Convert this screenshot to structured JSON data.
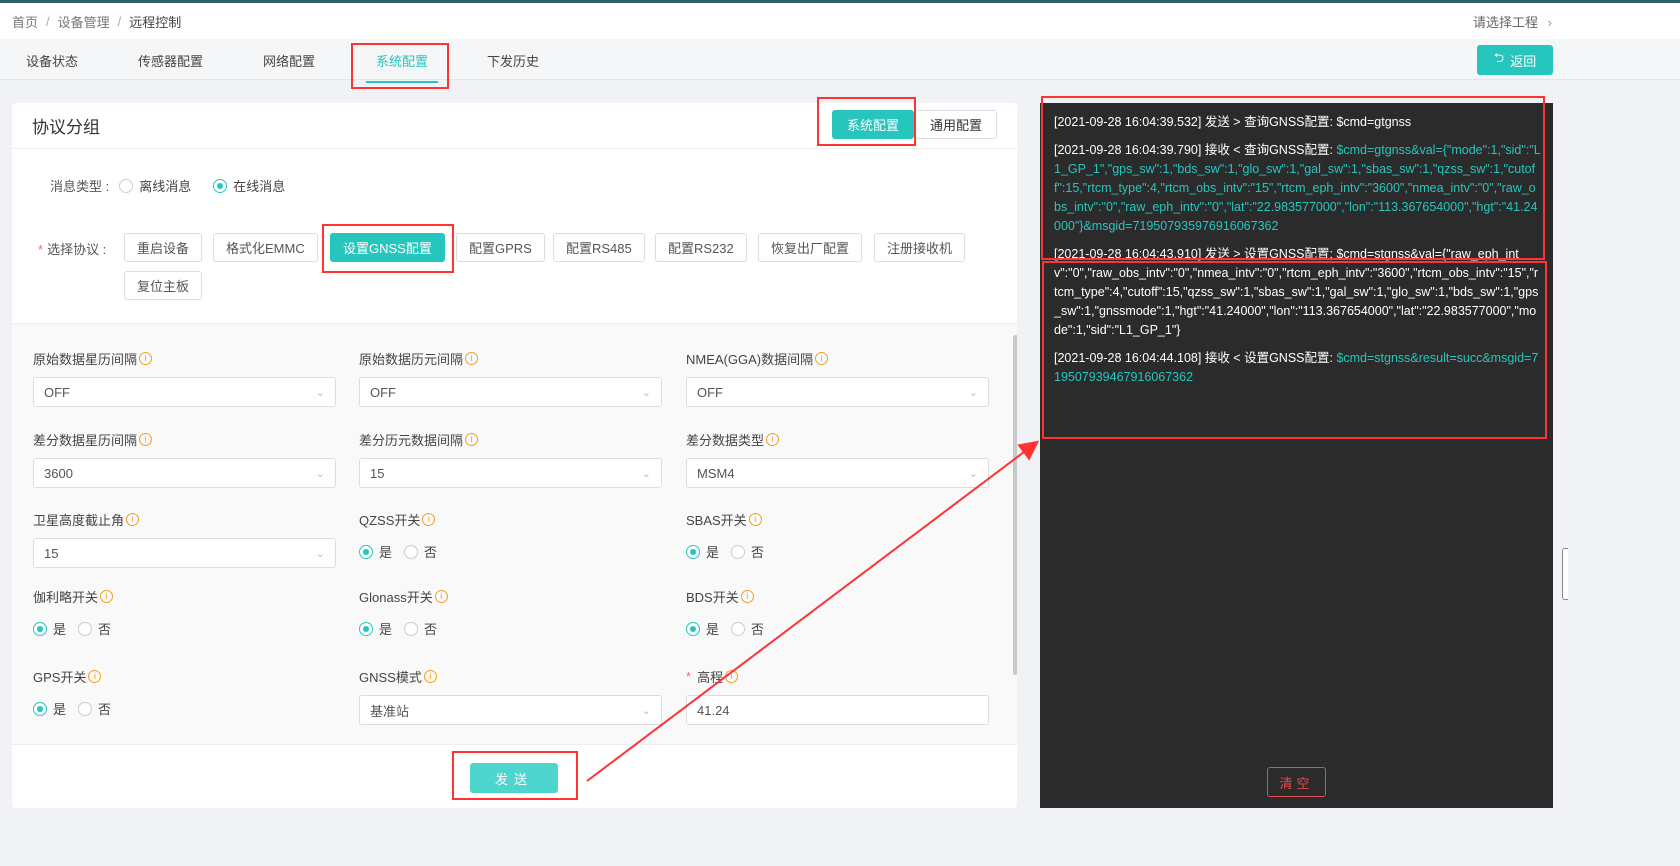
{
  "breadcrumb": [
    "首页",
    "设备管理",
    "远程控制"
  ],
  "project_selector": "请选择工程",
  "tabs": [
    {
      "label": "设备状态"
    },
    {
      "label": "传感器配置"
    },
    {
      "label": "网络配置"
    },
    {
      "label": "系统配置",
      "active": true
    },
    {
      "label": "下发历史"
    }
  ],
  "back_label": "返回",
  "panel": {
    "title": "协议分组",
    "group_buttons": [
      {
        "label": "系统配置",
        "active": true
      },
      {
        "label": "通用配置"
      }
    ]
  },
  "message_type": {
    "label": "消息类型 :",
    "options": [
      "离线消息",
      "在线消息"
    ],
    "selected": "在线消息"
  },
  "protocol": {
    "label": "选择协议 :",
    "buttons": [
      "重启设备",
      "格式化EMMC",
      "设置GNSS配置",
      "配置GPRS",
      "配置RS485",
      "配置RS232",
      "恢复出厂配置",
      "注册接收机",
      "复位主板"
    ],
    "selected": "设置GNSS配置"
  },
  "fields": [
    {
      "label": "原始数据星历间隔",
      "type": "select",
      "value": "OFF"
    },
    {
      "label": "原始数据历元间隔",
      "type": "select",
      "value": "OFF"
    },
    {
      "label": "NMEA(GGA)数据间隔",
      "type": "select",
      "value": "OFF"
    },
    {
      "label": "差分数据星历间隔",
      "type": "select",
      "value": "3600"
    },
    {
      "label": "差分历元数据间隔",
      "type": "select",
      "value": "15"
    },
    {
      "label": "差分数据类型",
      "type": "select",
      "value": "MSM4"
    },
    {
      "label": "卫星高度截止角",
      "type": "select",
      "value": "15"
    },
    {
      "label": "QZSS开关",
      "type": "radio",
      "options": [
        "是",
        "否"
      ],
      "value": "是"
    },
    {
      "label": "SBAS开关",
      "type": "radio",
      "options": [
        "是",
        "否"
      ],
      "value": "是"
    },
    {
      "label": "伽利略开关",
      "type": "radio",
      "options": [
        "是",
        "否"
      ],
      "value": "是"
    },
    {
      "label": "Glonass开关",
      "type": "radio",
      "options": [
        "是",
        "否"
      ],
      "value": "是"
    },
    {
      "label": "BDS开关",
      "type": "radio",
      "options": [
        "是",
        "否"
      ],
      "value": "是"
    },
    {
      "label": "GPS开关",
      "type": "radio",
      "options": [
        "是",
        "否"
      ],
      "value": "是"
    },
    {
      "label": "GNSS模式",
      "type": "select",
      "value": "基准站"
    },
    {
      "label": "高程",
      "type": "input",
      "value": "41.24",
      "required": true
    }
  ],
  "send_label": "发送",
  "clear_label": "清空",
  "logs": [
    {
      "prefix": "[2021-09-28 16:04:39.532] 发送 > 查询GNSS配置:  ",
      "payload": "$cmd=gtgnss",
      "dir": "send"
    },
    {
      "prefix": "[2021-09-28 16:04:39.790] 接收 < 查询GNSS配置:  ",
      "payload": "$cmd=gtgnss&val={\"mode\":1,\"sid\":\"L1_GP_1\",\"gps_sw\":1,\"bds_sw\":1,\"glo_sw\":1,\"gal_sw\":1,\"sbas_sw\":1,\"qzss_sw\":1,\"cutoff\":15,\"rtcm_type\":4,\"rtcm_obs_intv\":\"15\",\"rtcm_eph_intv\":\"3600\",\"nmea_intv\":\"0\",\"raw_obs_intv\":\"0\",\"raw_eph_intv\":\"0\",\"lat\":\"22.983577000\",\"lon\":\"113.367654000\",\"hgt\":\"41.24000\"}&msgid=719507935976916067362",
      "dir": "recv"
    },
    {
      "prefix": "[2021-09-28 16:04:43.910] 发送 > 设置GNSS配置:  ",
      "payload": "$cmd=stgnss&val={\"raw_eph_intv\":\"0\",\"raw_obs_intv\":\"0\",\"nmea_intv\":\"0\",\"rtcm_eph_intv\":\"3600\",\"rtcm_obs_intv\":\"15\",\"rtcm_type\":4,\"cutoff\":15,\"qzss_sw\":1,\"sbas_sw\":1,\"gal_sw\":1,\"glo_sw\":1,\"bds_sw\":1,\"gps_sw\":1,\"gnssmode\":1,\"hgt\":\"41.24000\",\"lon\":\"113.367654000\",\"lat\":\"22.983577000\",\"mode\":1,\"sid\":\"L1_GP_1\"}",
      "dir": "send"
    },
    {
      "prefix": "[2021-09-28 16:04:44.108] 接收 < 设置GNSS配置:  ",
      "payload": "$cmd=stgnss&result=succ&msgid=719507939467916067362",
      "dir": "recv"
    }
  ],
  "colors": {
    "accent": "#26c6be",
    "annotation": "#ff3333",
    "log_bg": "#2b2b2b",
    "info": "#f0a020"
  }
}
